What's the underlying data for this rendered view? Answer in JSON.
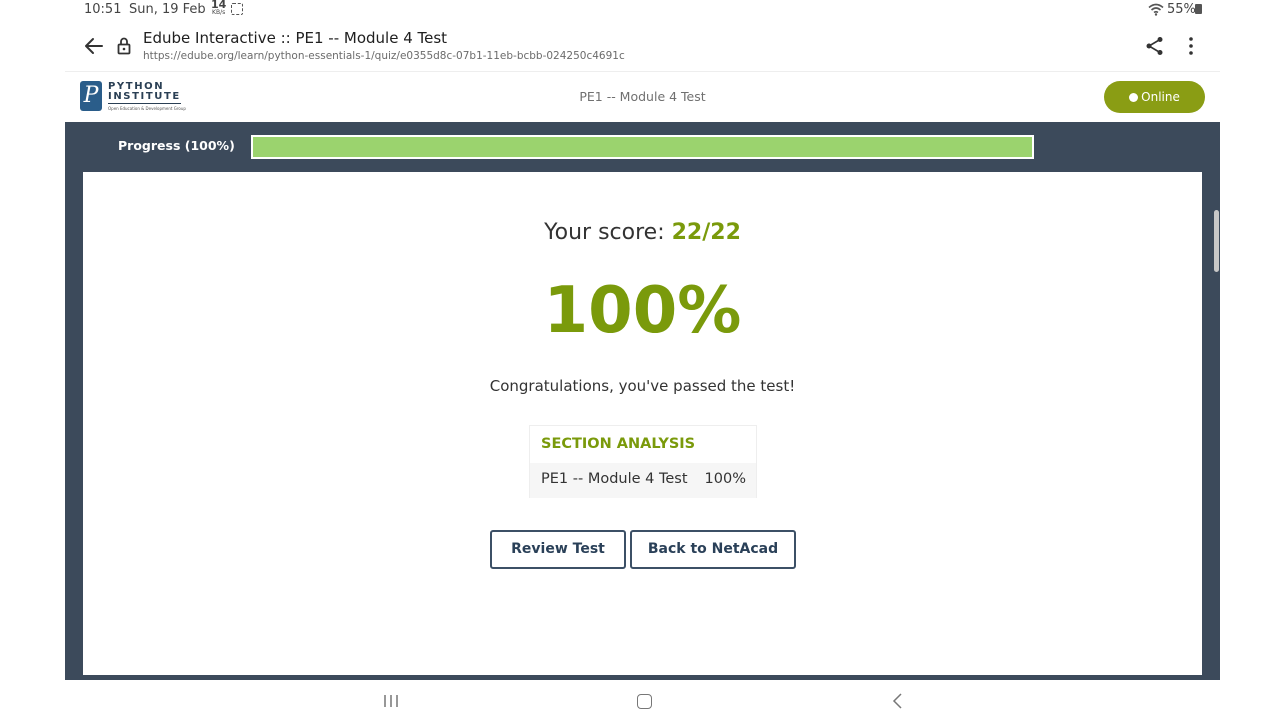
{
  "status_bar": {
    "time": "10:51",
    "date": "Sun, 19 Feb",
    "net_speed": "14",
    "net_unit": "KB/s",
    "battery": "55%"
  },
  "browser": {
    "title": "Edube Interactive :: PE1 -- Module 4 Test",
    "url": "https://edube.org/learn/python-essentials-1/quiz/e0355d8c-07b1-11eb-bcbb-024250c4691c"
  },
  "site_header": {
    "logo_line1": "PYTHON",
    "logo_line2": "INSTITUTE",
    "logo_tagline": "Open Education & Development Group",
    "title": "PE1 -- Module 4 Test",
    "online_label": "Online"
  },
  "progress": {
    "label": "Progress (100%)",
    "fraction": 1.0
  },
  "result": {
    "score_prefix": "Your score: ",
    "score_value": "22/22",
    "percent": "100%",
    "message": "Congratulations, you've passed the test!"
  },
  "section_analysis": {
    "heading": "SECTION ANALYSIS",
    "rows": [
      {
        "name": "PE1 -- Module 4 Test",
        "percent": "100%"
      }
    ]
  },
  "buttons": {
    "review": "Review Test",
    "back": "Back to NetAcad"
  },
  "colors": {
    "accent_green": "#7a9a0b",
    "online_badge": "#8a9d14",
    "progress_fill": "#9bd36e",
    "frame_bg": "#3c4a5b"
  }
}
